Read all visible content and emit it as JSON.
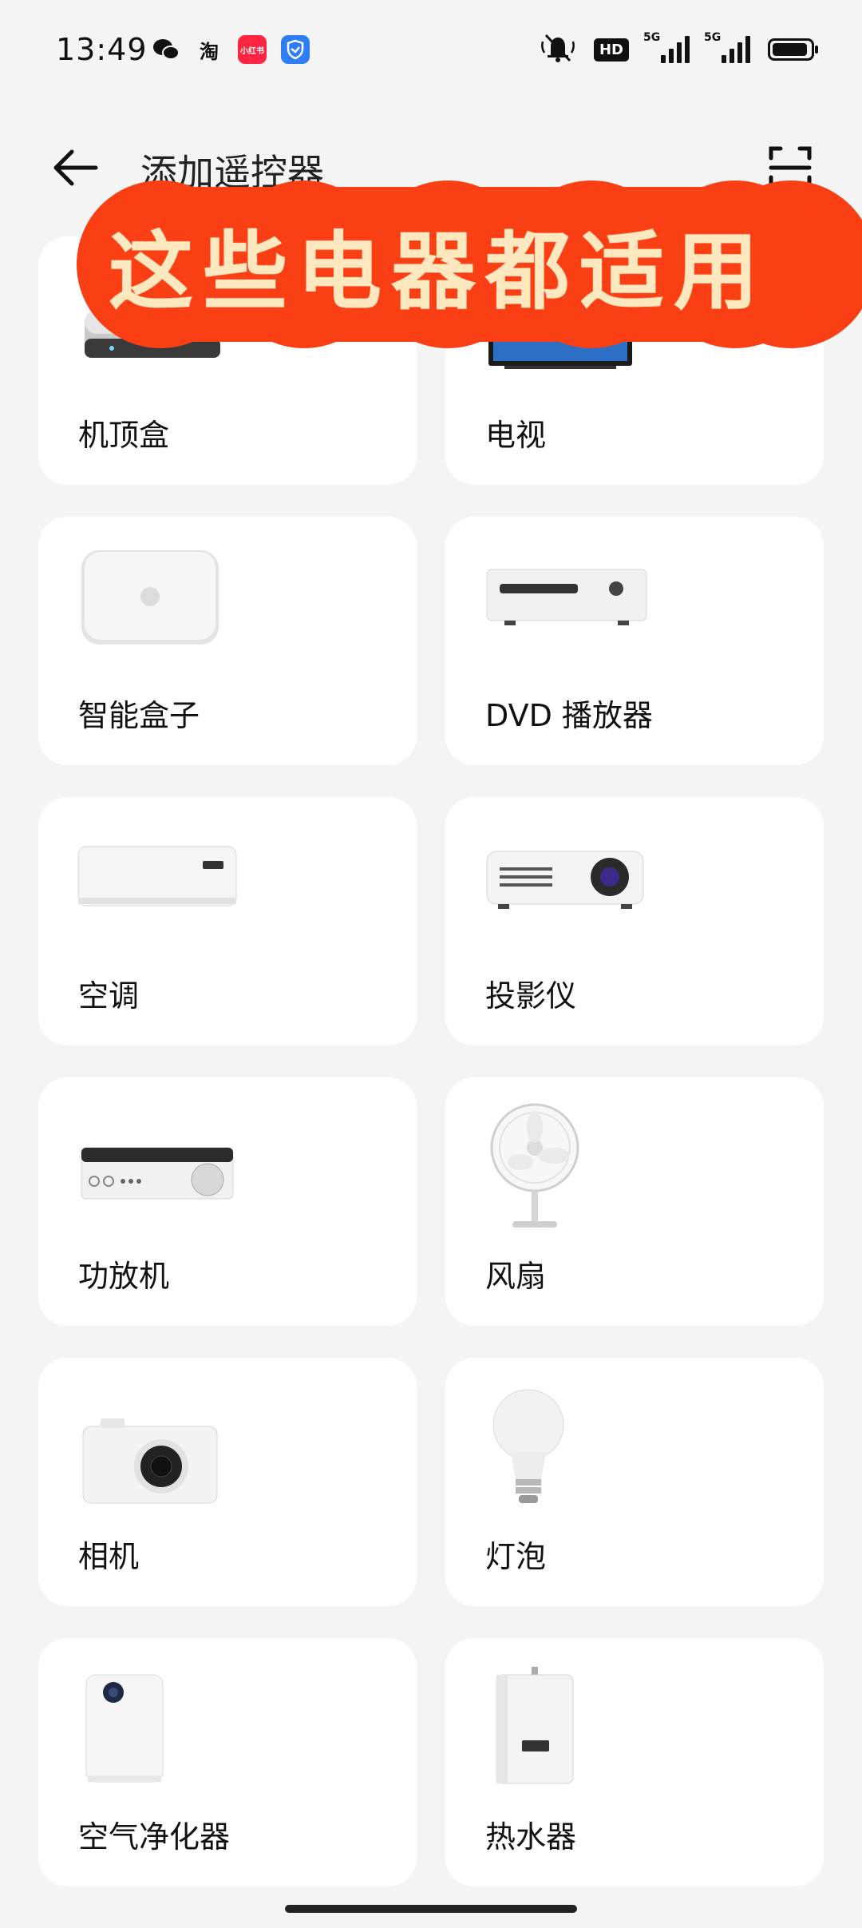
{
  "status_bar": {
    "time": "13:49",
    "apps": [
      {
        "name": "wechat-icon"
      },
      {
        "name": "taobao-icon",
        "text": "淘"
      },
      {
        "name": "xiaohongshu-icon",
        "text": "小红书",
        "color": "#ff2442"
      },
      {
        "name": "security-shield-icon",
        "color": "#2f7df6"
      }
    ],
    "hd_badge": "HD",
    "network_1": "5G",
    "network_2": "5G"
  },
  "header": {
    "title": "添加遥控器"
  },
  "banner": {
    "text": "这些电器都适用",
    "color": "#fb3f14",
    "text_color": "#fde8c0"
  },
  "devices": [
    {
      "label": "机顶盒",
      "icon": "set-top-box-icon"
    },
    {
      "label": "电视",
      "icon": "tv-icon"
    },
    {
      "label": "智能盒子",
      "icon": "smart-box-icon"
    },
    {
      "label": "DVD 播放器",
      "icon": "dvd-player-icon"
    },
    {
      "label": "空调",
      "icon": "air-conditioner-icon"
    },
    {
      "label": "投影仪",
      "icon": "projector-icon"
    },
    {
      "label": "功放机",
      "icon": "amplifier-icon"
    },
    {
      "label": "风扇",
      "icon": "fan-icon"
    },
    {
      "label": "相机",
      "icon": "camera-icon"
    },
    {
      "label": "灯泡",
      "icon": "light-bulb-icon"
    },
    {
      "label": "空气净化器",
      "icon": "air-purifier-icon"
    },
    {
      "label": "热水器",
      "icon": "water-heater-icon"
    }
  ]
}
